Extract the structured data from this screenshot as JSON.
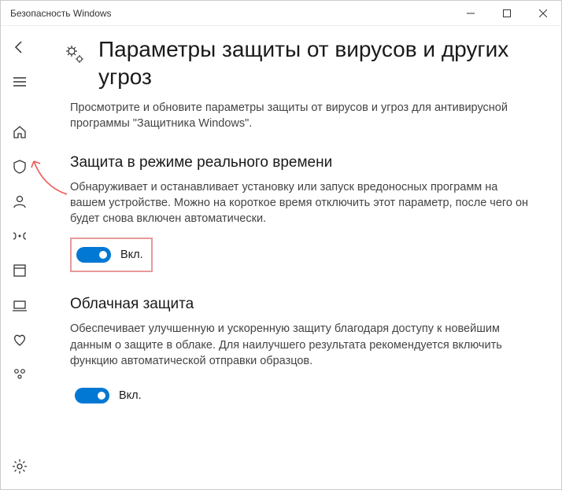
{
  "window": {
    "title": "Безопасность Windows"
  },
  "sidebar": {
    "items": [
      "back",
      "menu",
      "home",
      "virus-protection",
      "account-protection",
      "firewall",
      "app-browser-control",
      "device-security",
      "device-performance",
      "family-options"
    ],
    "settings": "settings"
  },
  "page": {
    "title": "Параметры защиты от вирусов и других угроз",
    "description": "Просмотрите и обновите параметры защиты от вирусов и угроз для антивирусной программы \"Защитника Windows\"."
  },
  "sections": [
    {
      "title": "Защита в режиме реального времени",
      "description": "Обнаруживает и останавливает установку или запуск вредоносных программ на вашем устройстве. Можно на короткое время отключить этот параметр, после чего он будет снова включен автоматически.",
      "toggle_label": "Вкл.",
      "highlighted": true
    },
    {
      "title": "Облачная защита",
      "description": "Обеспечивает улучшенную и ускоренную защиту благодаря доступу к новейшим данным о защите в облаке. Для наилучшего результата рекомендуется включить функцию автоматической отправки образцов.",
      "toggle_label": "Вкл.",
      "highlighted": false
    }
  ]
}
